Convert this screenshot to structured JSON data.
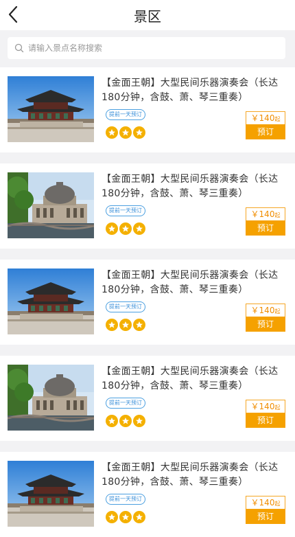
{
  "header": {
    "title": "景区",
    "back_icon": "chevron-left-icon"
  },
  "search": {
    "placeholder": "请输入景点名称搜索",
    "value": "",
    "icon": "search-icon"
  },
  "items": [
    {
      "image": "palace",
      "name": "【金面王朝】大型民间乐器演奏会（长达180分钟，含鼓、萧、琴三重奏）",
      "tag": "提前一天预订",
      "stars": 3,
      "price_symbol": "￥",
      "price": "140",
      "price_suffix": "起",
      "book_label": "预订"
    },
    {
      "image": "museum",
      "name": "【金面王朝】大型民间乐器演奏会（长达180分钟，含鼓、萧、琴三重奏）",
      "tag": "提前一天预订",
      "stars": 3,
      "price_symbol": "￥",
      "price": "140",
      "price_suffix": "起",
      "book_label": "预订"
    },
    {
      "image": "palace",
      "name": "【金面王朝】大型民间乐器演奏会（长达180分钟，含鼓、萧、琴三重奏）",
      "tag": "提前一天预订",
      "stars": 3,
      "price_symbol": "￥",
      "price": "140",
      "price_suffix": "起",
      "book_label": "预订"
    },
    {
      "image": "museum",
      "name": "【金面王朝】大型民间乐器演奏会（长达180分钟，含鼓、萧、琴三重奏）",
      "tag": "提前一天预订",
      "stars": 3,
      "price_symbol": "￥",
      "price": "140",
      "price_suffix": "起",
      "book_label": "预订"
    },
    {
      "image": "palace",
      "name": "【金面王朝】大型民间乐器演奏会（长达180分钟，含鼓、萧、琴三重奏）",
      "tag": "提前一天预订",
      "stars": 3,
      "price_symbol": "￥",
      "price": "140",
      "price_suffix": "起",
      "book_label": "预订"
    }
  ],
  "colors": {
    "accent": "#f5a100",
    "tag_blue": "#3a8fd8",
    "star": "#f4b000"
  }
}
